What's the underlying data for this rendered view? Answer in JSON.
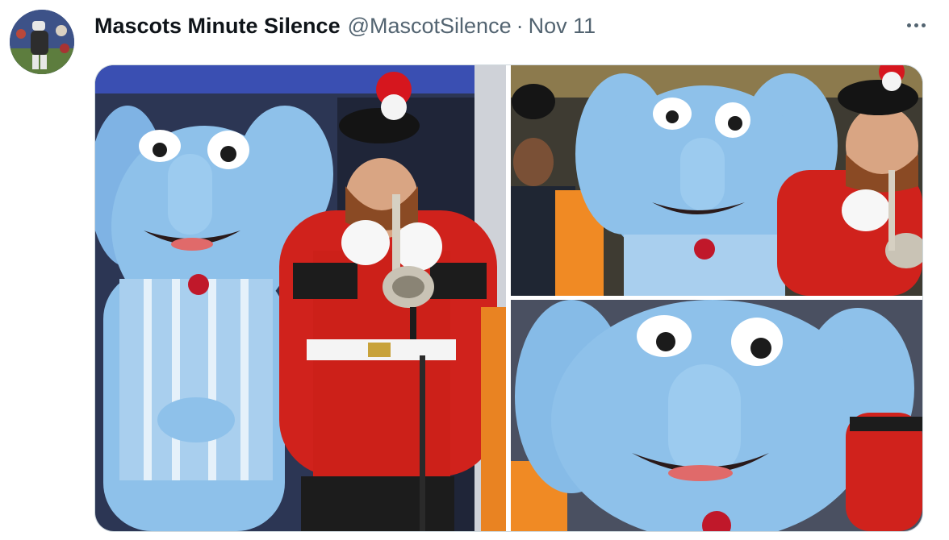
{
  "tweet": {
    "author_name": "Mascots Minute Silence",
    "handle": "@MascotSilence",
    "separator": "·",
    "date": "Nov 11"
  },
  "icons": {
    "more": "more-horizontal-icon"
  },
  "media": {
    "count": 3,
    "photos": [
      {
        "label": "bugler-and-elephant-mascot"
      },
      {
        "label": "elephant-mascot-and-bugler-closeup"
      },
      {
        "label": "elephant-mascot-face-closeup"
      }
    ]
  },
  "colors": {
    "name": "#0f1419",
    "secondary": "#536471",
    "border": "#cfd9de",
    "mascot_blue": "#8ec1ea",
    "tunic_red": "#d0221c"
  }
}
